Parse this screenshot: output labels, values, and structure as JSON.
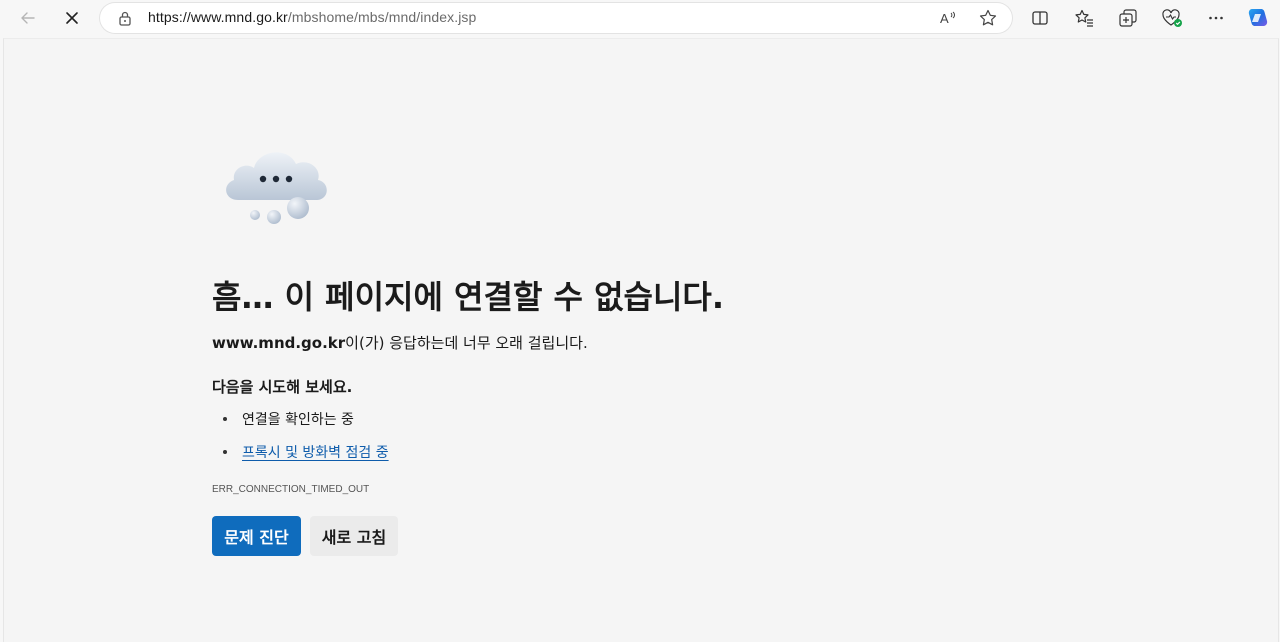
{
  "browser": {
    "url_host": "https://www.mnd.go.kr",
    "url_path": "/mbshome/mbs/mnd/index.jsp",
    "accent_color": "#0f6cbd",
    "icons": [
      "back-arrow-icon",
      "stop-loading-icon",
      "lock-icon",
      "read-aloud-icon",
      "favorite-star-icon",
      "split-screen-icon",
      "favorites-icon",
      "collections-icon",
      "browser-essentials-icon",
      "more-icon",
      "copilot-icon"
    ]
  },
  "error_page": {
    "title": "흠… 이 페이지에 연결할 수 없습니다.",
    "host": "www.mnd.go.kr",
    "description_suffix": "이(가) 응답하는데 너무 오래 걸립니다.",
    "try_heading": "다음을 시도해 보세요.",
    "suggestions": [
      {
        "text": "연결을 확인하는 중",
        "is_link": false
      },
      {
        "text": "프록시 및 방화벽 점검 중",
        "is_link": true
      }
    ],
    "error_code": "ERR_CONNECTION_TIMED_OUT",
    "buttons": {
      "diagnose": "문제 진단",
      "refresh": "새로 고침"
    }
  }
}
